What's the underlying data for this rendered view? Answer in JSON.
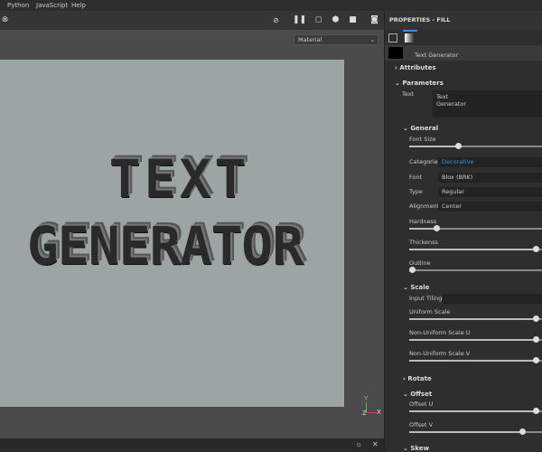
{
  "menu": [
    "Python",
    "JavaScript",
    "Help"
  ],
  "viewport": {
    "material_select": "Material",
    "canvas_text": [
      "TEXT",
      "GENERATOR"
    ],
    "axes": {
      "y": "Y",
      "x": "X",
      "z": "Z"
    }
  },
  "panel": {
    "title": "PROPERTIES - FILL",
    "resource_name": "Text Generator",
    "sections": {
      "attributes": "Attributes",
      "parameters": "Parameters",
      "general": "General",
      "scale": "Scale",
      "rotate": "Rotate",
      "offset": "Offset",
      "skew": "Skew"
    },
    "text_label": "Text",
    "text_value": [
      "Text",
      "Generator"
    ],
    "fields": [
      {
        "label": "Categorie",
        "value": "Decorative",
        "accent": "#3b8fd9"
      },
      {
        "label": "Font",
        "value": "Blox (BRK)"
      },
      {
        "label": "Type",
        "value": "Regular"
      },
      {
        "label": "Alignment",
        "value": "Center"
      }
    ],
    "sliders_general": [
      {
        "label": "Font Size",
        "value": 0.36
      },
      {
        "label": "Hardness",
        "value": 0.2
      },
      {
        "label": "Thickenss",
        "value": 0.93
      },
      {
        "label": "Outline",
        "value": 0.02
      }
    ],
    "input_tiling_label": "Input Tiling",
    "sliders_scale": [
      {
        "label": "Uniform Scale",
        "value": 0.93
      },
      {
        "label": "Non-Uniform Scale U",
        "value": 0.93
      },
      {
        "label": "Non-Uniform Scale V",
        "value": 0.93
      }
    ],
    "sliders_offset": [
      {
        "label": "Offset U",
        "value": 0.93
      },
      {
        "label": "Offset V",
        "value": 0.83
      }
    ]
  }
}
